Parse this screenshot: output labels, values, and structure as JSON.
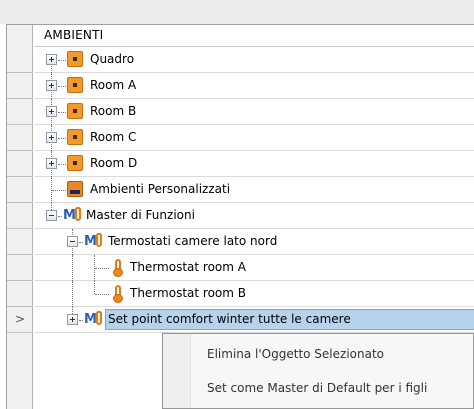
{
  "header": {
    "title": "AMBIENTI"
  },
  "tree": [
    {
      "label": "Quadro",
      "icon": "room-icon",
      "expander": "plus"
    },
    {
      "label": "Room A",
      "icon": "room-icon",
      "expander": "plus"
    },
    {
      "label": "Room B",
      "icon": "room-icon",
      "expander": "plus"
    },
    {
      "label": "Room C",
      "icon": "room-icon",
      "expander": "plus"
    },
    {
      "label": "Room D",
      "icon": "room-icon",
      "expander": "plus"
    },
    {
      "label": "Ambienti Personalizzati",
      "icon": "custom-environment-icon",
      "expander": "none"
    },
    {
      "label": "Master di Funzioni",
      "icon": "master-function-icon",
      "expander": "minus"
    },
    {
      "label": "Termostati camere lato nord",
      "icon": "master-function-icon",
      "expander": "minus"
    },
    {
      "label": "Thermostat room A",
      "icon": "thermometer-icon",
      "expander": "none"
    },
    {
      "label": "Thermostat room B",
      "icon": "thermometer-icon",
      "expander": "none"
    },
    {
      "label": "Set point comfort winter tutte le camere",
      "icon": "master-function-icon",
      "expander": "plus",
      "selected": true
    }
  ],
  "current_row_marker": ">",
  "context_menu": {
    "items": [
      "Elimina l'Oggetto Selezionato",
      "Set come Master di Default per i figli"
    ]
  },
  "colors": {
    "selection": "#b5d3ec",
    "room_icon": "#f39a2a",
    "master_icon_letter": "#2b5fb4"
  }
}
